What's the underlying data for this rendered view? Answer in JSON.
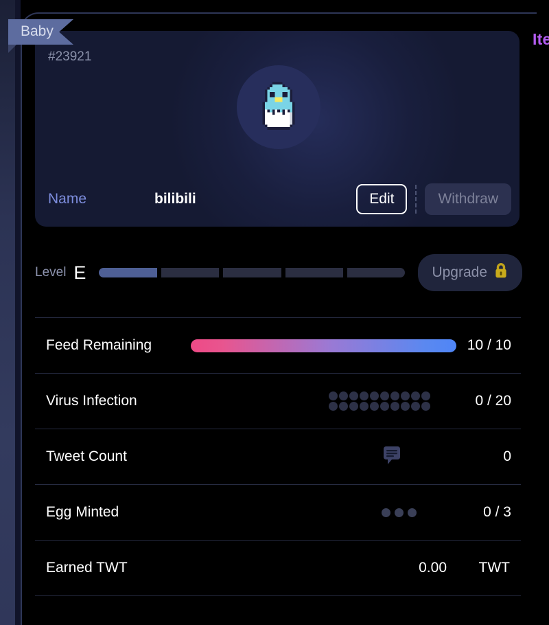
{
  "page": {
    "background_color": "#000000",
    "accent_color": "#b35cf0",
    "edge_strip_color": "#2c3354"
  },
  "side_label": {
    "text": "Ite",
    "full_hint": "Items",
    "color": "#b35cf0"
  },
  "ribbon": {
    "label": "Baby",
    "background_color": "#5d6c9f",
    "text_color": "#d7dcec"
  },
  "profile_card": {
    "serial": "#23921",
    "avatar": {
      "icon": "pixel-chick-egg-avatar",
      "circle_color": "#272e5c",
      "body_color": "#76cfe0",
      "beak_color": "#f5e960",
      "shell_color": "#ffffff",
      "outline_color": "#1b1d3a"
    },
    "name_row": {
      "label": "Name",
      "value": "bilibili",
      "edit_label": "Edit",
      "withdraw_label": "Withdraw"
    }
  },
  "level_row": {
    "label": "Level",
    "value": "E",
    "segments_total": 5,
    "segments_filled": 1,
    "filled_color": "#4e5f95",
    "empty_color": "#2b2e41",
    "upgrade_label": "Upgrade",
    "upgrade_icon": "lock-icon",
    "lock_color": "#bfa21c"
  },
  "stats": [
    {
      "label": "Feed Remaining",
      "value": "10 / 10",
      "indicator": "gradient-bar",
      "current": 10,
      "max": 10,
      "bar_from": "#ef4a86",
      "bar_to": "#4f86f7"
    },
    {
      "label": "Virus Infection",
      "value": "0 / 20",
      "indicator": "dot-grid",
      "current": 0,
      "max": 20,
      "dot_color": "#2d3147"
    },
    {
      "label": "Tweet Count",
      "value": "0",
      "indicator": "speech-bubble-icon",
      "icon_color": "#3d4266"
    },
    {
      "label": "Egg Minted",
      "value": "0 / 3",
      "indicator": "dot-row",
      "current": 0,
      "max": 3,
      "dot_color": "#3a3f57"
    },
    {
      "label": "Earned TWT",
      "value": "0.00",
      "unit": "TWT",
      "indicator": "none"
    }
  ]
}
